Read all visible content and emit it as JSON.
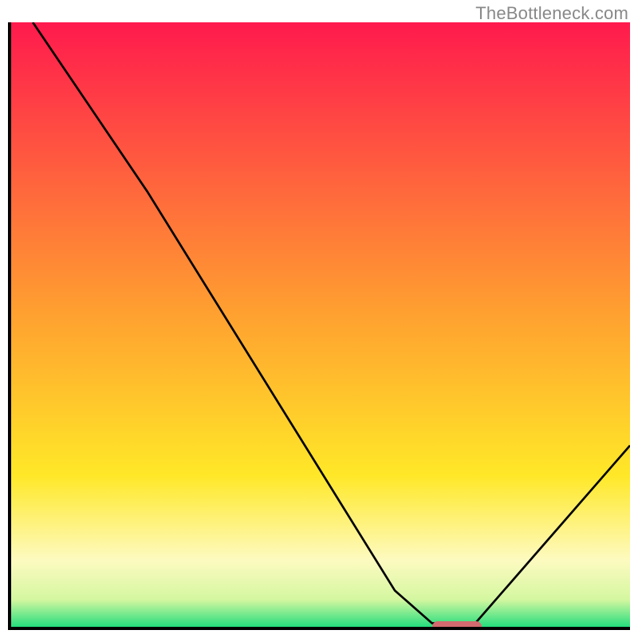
{
  "watermark": "TheBottleneck.com",
  "chart_data": {
    "type": "line",
    "title": "",
    "xlabel": "",
    "ylabel": "",
    "xlim": [
      0,
      100
    ],
    "ylim": [
      0,
      100
    ],
    "grid": false,
    "gradient_stops": [
      {
        "offset": 0,
        "color": "#ff1a4d"
      },
      {
        "offset": 0.48,
        "color": "#ffa030"
      },
      {
        "offset": 0.75,
        "color": "#ffe828"
      },
      {
        "offset": 0.89,
        "color": "#fdfac0"
      },
      {
        "offset": 0.955,
        "color": "#d4f7a0"
      },
      {
        "offset": 1.0,
        "color": "#25dd7e"
      }
    ],
    "series": [
      {
        "name": "bottleneck-curve",
        "color": "#000000",
        "width": 2,
        "points": [
          {
            "x": 3.5,
            "y": 100
          },
          {
            "x": 22,
            "y": 72
          },
          {
            "x": 62,
            "y": 6
          },
          {
            "x": 68,
            "y": 0.6
          },
          {
            "x": 75,
            "y": 0.6
          },
          {
            "x": 100,
            "y": 30
          }
        ]
      }
    ],
    "marker": {
      "x_start": 68,
      "x_end": 76,
      "y": 0,
      "color": "#d36a6f"
    }
  }
}
